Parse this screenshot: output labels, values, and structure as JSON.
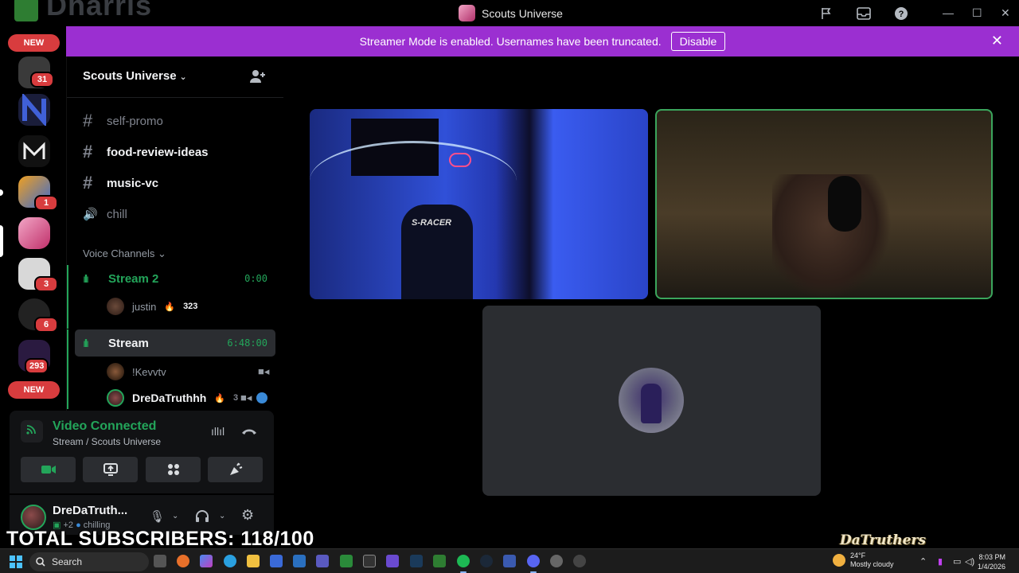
{
  "window": {
    "app_wordmark": "Dharris",
    "title": "Scouts Universe"
  },
  "banner": {
    "message": "Streamer Mode is enabled. Usernames have been truncated.",
    "disable_label": "Disable",
    "close_icon": "✕"
  },
  "rail": {
    "new_label_top": "NEW",
    "new_label_bottom": "NEW",
    "badges": [
      "31",
      "1",
      "3",
      "6",
      "293"
    ]
  },
  "server": {
    "name": "Scouts Universe",
    "chevron": "⌄"
  },
  "channels": [
    {
      "name": "self-promo",
      "icon": "#"
    },
    {
      "name": "food-review-ideas",
      "icon": "#"
    },
    {
      "name": "music-vc",
      "icon": "#"
    },
    {
      "name": "chill",
      "icon": "🔊"
    }
  ],
  "voice_section": {
    "label": "Voice Channels",
    "chevron": "⌄"
  },
  "voice_channels": [
    {
      "name": "Stream 2",
      "timer": "0:00",
      "users": [
        {
          "name": "justin",
          "count": "323"
        }
      ]
    },
    {
      "name": "Stream",
      "timer": "6:48:00",
      "users": [
        {
          "name": "!Kevvtv"
        },
        {
          "name": "DreDaTruthhh",
          "count": "3"
        }
      ]
    }
  ],
  "voice_panel": {
    "title": "Video Connected",
    "subtitle": "Stream / Scouts Universe"
  },
  "user_panel": {
    "name": "DreDaTruth...",
    "status_prefix": "+2",
    "status": "chilling"
  },
  "video": {
    "chair_brand": "S-RACER"
  },
  "overlay": {
    "subscribers": "TOTAL SUBSCRIBERS: 118/100",
    "signature": "DaTruthers"
  },
  "taskbar": {
    "search_label": "Search",
    "weather_temp": "24°F",
    "weather_desc": "Mostly cloudy",
    "time": "8:03 PM",
    "date": "1/4/2026"
  },
  "colors": {
    "accent_green": "#23a55a",
    "banner_purple": "#9b2fd1",
    "badge_red": "#d83c3e"
  }
}
